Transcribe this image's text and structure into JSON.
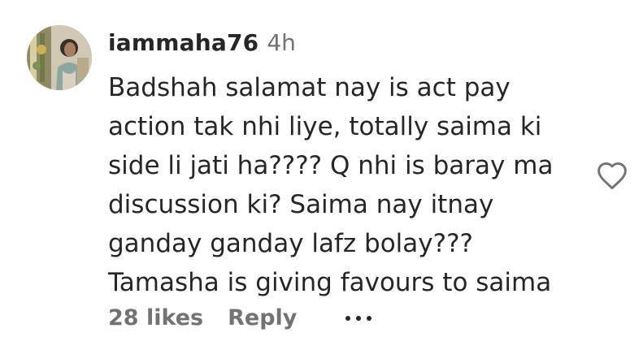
{
  "comment": {
    "username": "iammaha76",
    "timestamp": "4h",
    "text_lines": [
      "Badshah salamat nay is act pay",
      "action tak nhi liye, totally saima ki",
      "side li jati ha???? Q nhi is baray ma",
      "discussion ki? Saima nay itnay",
      "ganday ganday lafz bolay???",
      "Tamasha is giving favours to saima"
    ],
    "likes_label": "28 likes",
    "reply_label": "Reply",
    "icons": {
      "like": "heart-icon",
      "more": "more-options-icon"
    }
  },
  "colors": {
    "text": "#262626",
    "secondary": "#737373",
    "background": "#ffffff"
  }
}
